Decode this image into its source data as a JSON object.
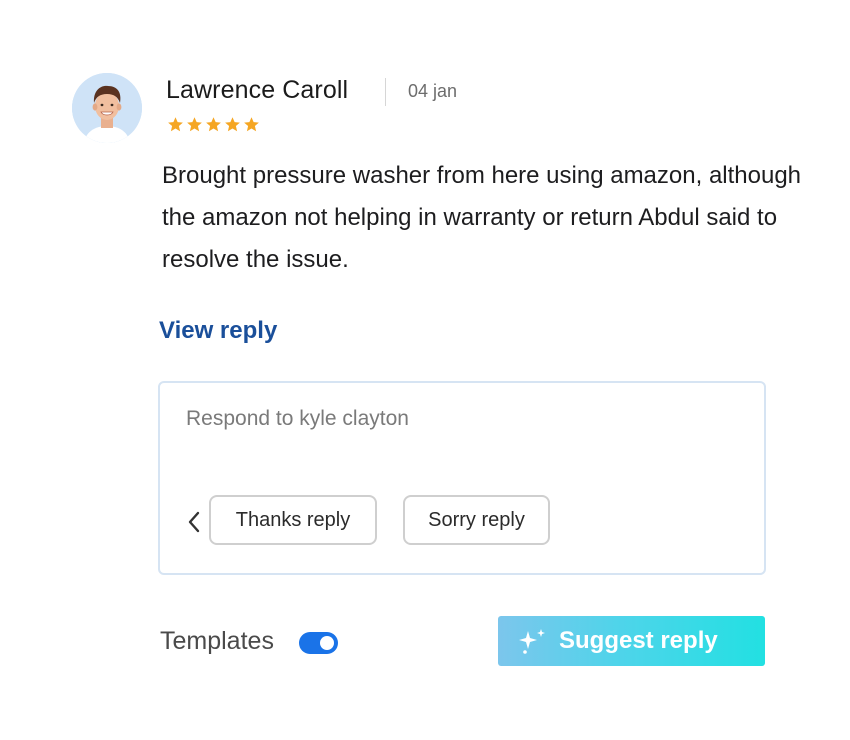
{
  "review": {
    "author": "Lawrence Caroll",
    "date": "04 jan",
    "rating": 5,
    "rating_max": 5,
    "text": "Brought pressure washer from here using amazon, although the amazon not helping in warranty or return Abdul said to resolve the issue."
  },
  "links": {
    "view_reply": "View reply"
  },
  "reply_box": {
    "placeholder": "Respond to kyle clayton",
    "value": "",
    "chips": [
      "Thanks reply",
      "Sorry reply"
    ]
  },
  "footer": {
    "templates_label": "Templates",
    "templates_enabled": true,
    "suggest_label": "Suggest reply"
  },
  "colors": {
    "star": "#f5a623",
    "link": "#1a4f9a",
    "toggle_on": "#1a73e8",
    "suggest_gradient_start": "#7cc6ec",
    "suggest_gradient_end": "#22e0e2"
  },
  "icons": {
    "avatar": "user-avatar",
    "rating": "star-icon",
    "nav": "chevron-left-icon",
    "suggest": "sparkle-icon"
  }
}
